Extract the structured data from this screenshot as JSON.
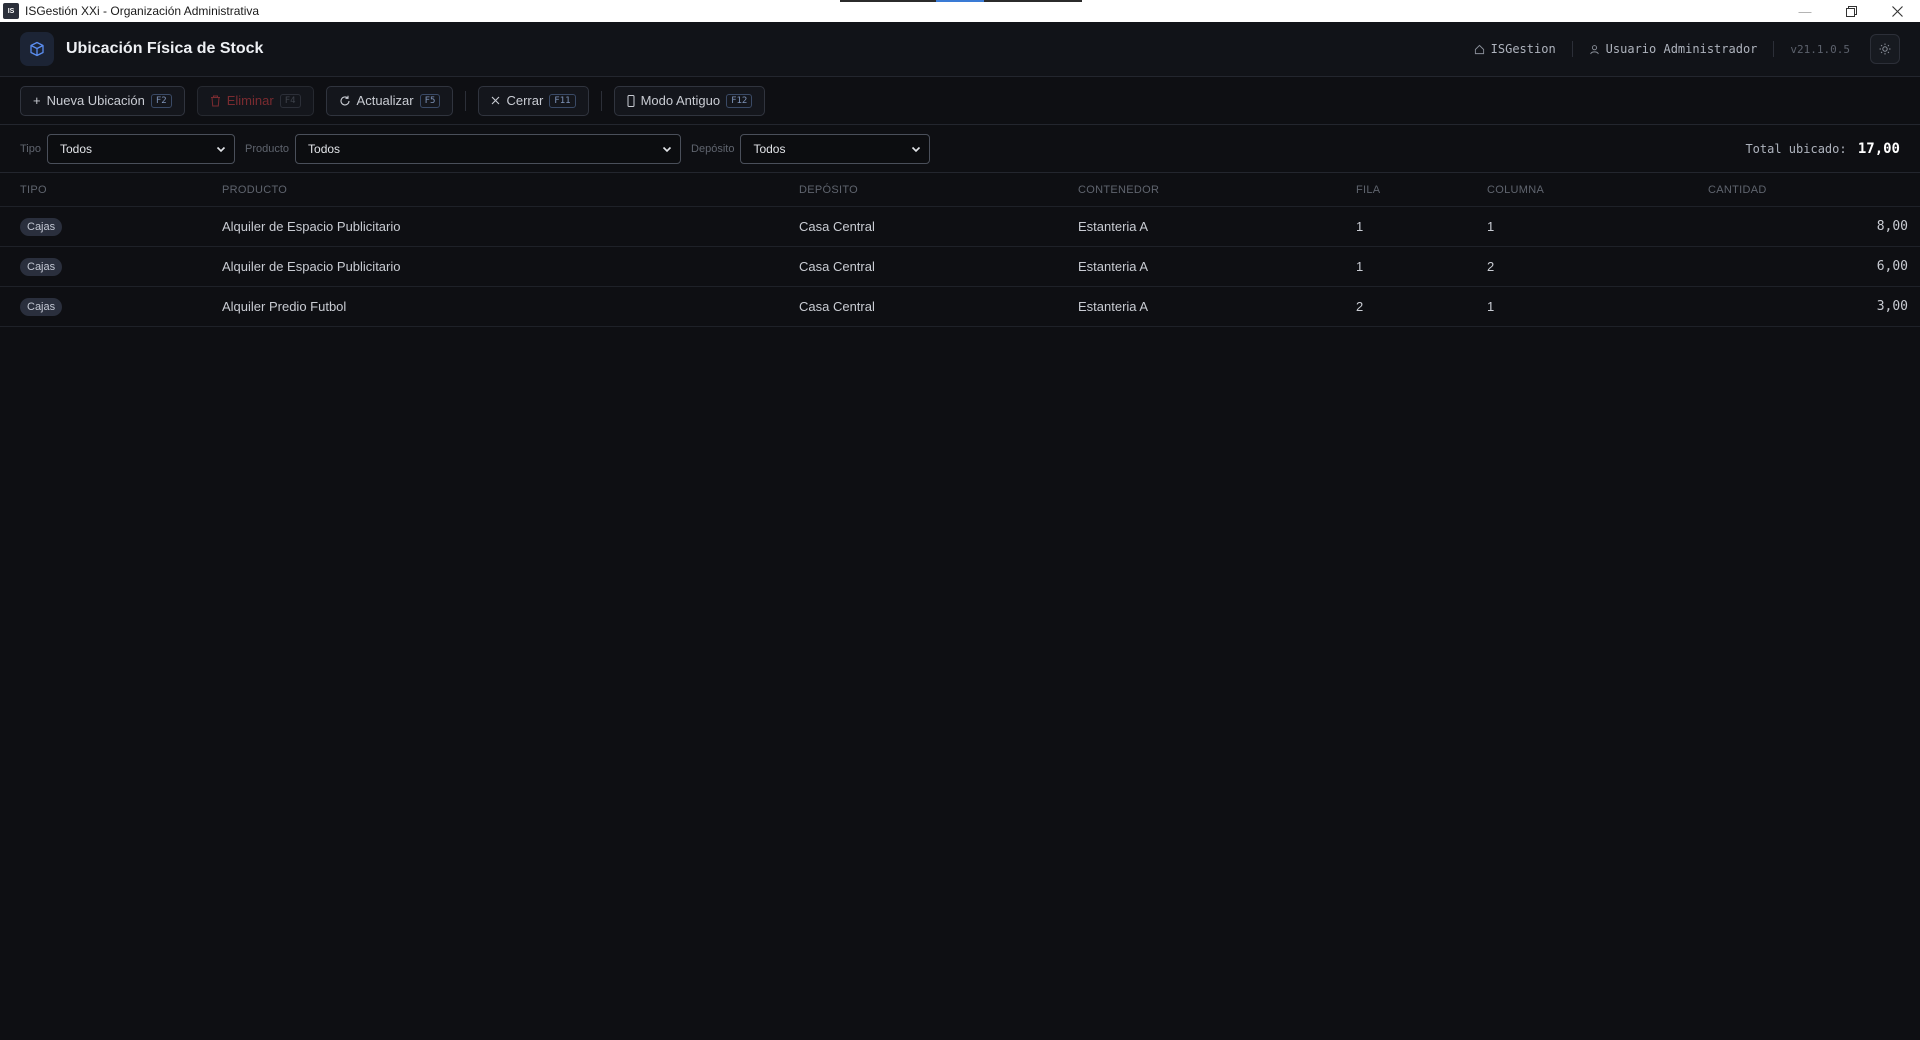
{
  "window": {
    "title": "ISGestión XXi - Organización Administrativa",
    "icon_label": "IS"
  },
  "header": {
    "title": "Ubicación Física de Stock",
    "company": "ISGestion",
    "user": "Usuario Administrador",
    "version": "v21.1.0.5"
  },
  "toolbar": {
    "new": {
      "label": "Nueva Ubicación",
      "key": "F2"
    },
    "delete": {
      "label": "Eliminar",
      "key": "F4"
    },
    "refresh": {
      "label": "Actualizar",
      "key": "F5"
    },
    "close": {
      "label": "Cerrar",
      "key": "F11"
    },
    "legacy": {
      "label": "Modo Antiguo",
      "key": "F12"
    }
  },
  "filters": {
    "tipo": {
      "label": "Tipo",
      "value": "Todos"
    },
    "producto": {
      "label": "Producto",
      "value": "Todos"
    },
    "deposito": {
      "label": "Depósito",
      "value": "Todos"
    },
    "total_label": "Total ubicado:",
    "total_value": "17,00"
  },
  "table": {
    "headers": [
      "TIPO",
      "PRODUCTO",
      "DEPÓSITO",
      "CONTENEDOR",
      "FILA",
      "COLUMNA",
      "CANTIDAD"
    ],
    "rows": [
      {
        "tipo": "Cajas",
        "producto": "Alquiler de Espacio Publicitario",
        "deposito": "Casa Central",
        "contenedor": "Estanteria A",
        "fila": "1",
        "columna": "1",
        "cantidad": "8,00"
      },
      {
        "tipo": "Cajas",
        "producto": "Alquiler de Espacio Publicitario",
        "deposito": "Casa Central",
        "contenedor": "Estanteria A",
        "fila": "1",
        "columna": "2",
        "cantidad": "6,00"
      },
      {
        "tipo": "Cajas",
        "producto": "Alquiler Predio Futbol",
        "deposito": "Casa Central",
        "contenedor": "Estanteria A",
        "fila": "2",
        "columna": "1",
        "cantidad": "3,00"
      }
    ]
  },
  "colors": {
    "background": "#0e0f13",
    "accent": "#3a7bd5",
    "danger": "#7a2b30"
  }
}
